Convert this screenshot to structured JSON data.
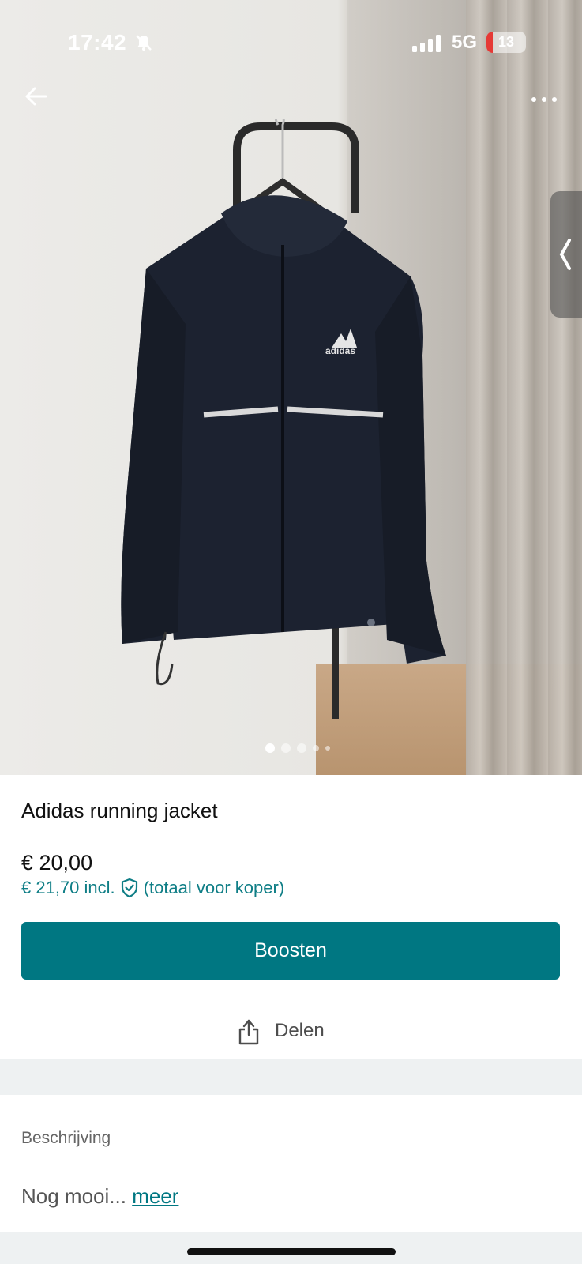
{
  "status_bar": {
    "time": "17:42",
    "network": "5G",
    "battery_level": "13",
    "icons": [
      "bell-off-icon",
      "signal-icon",
      "battery-icon"
    ]
  },
  "photo": {
    "image_count": 5,
    "active_index": 0,
    "icons": [
      "back-arrow-icon",
      "more-icon",
      "chevron-left-icon"
    ]
  },
  "item": {
    "title": "Adidas running jacket",
    "price": "€ 20,00",
    "price_incl": "€ 21,70 incl.",
    "price_incl_note": "(totaal voor koper)"
  },
  "actions": {
    "boost_label": "Boosten",
    "share_label": "Delen"
  },
  "description": {
    "label": "Beschrijving",
    "text": "Nog mooi...",
    "more_label": "meer"
  },
  "colors": {
    "accent": "#007782",
    "link": "#0f7e86",
    "band": "#eef1f2"
  }
}
